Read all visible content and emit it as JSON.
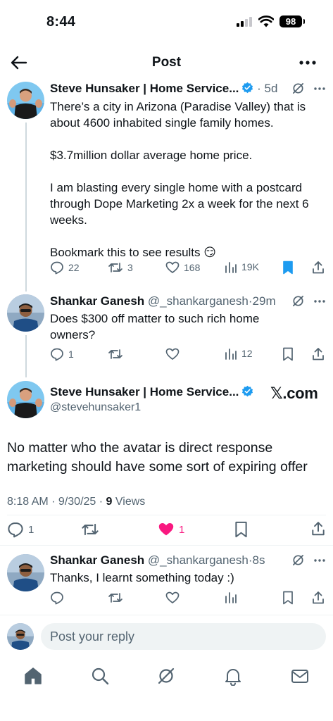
{
  "status_bar": {
    "time": "8:44",
    "battery": "98"
  },
  "header": {
    "title": "Post"
  },
  "posts": [
    {
      "author": "Steve Hunsaker | Home Service...",
      "time": "5d",
      "body": [
        "There’s a city in Arizona (Paradise Valley) that is about 4600 inhabited single family homes.",
        "$3.7million dollar average home price.",
        "I am blasting every single home with a postcard through Dope Marketing 2x a week for the next 6 weeks.",
        "Bookmark this to see results 😏"
      ],
      "replies": "22",
      "reposts": "3",
      "likes": "168",
      "views": "19K"
    },
    {
      "author": "Shankar Ganesh",
      "handle": "@_shankarganesh",
      "time": "29m",
      "body": "Does $300 off matter to such rich home owners?",
      "replies": "1",
      "views": "12"
    }
  ],
  "main_post": {
    "author": "Steve Hunsaker | Home Service...",
    "handle": "@stevehunsaker1",
    "source": "𝕏.com",
    "body": "No matter who the avatar is direct response marketing should have some sort of expiring offer",
    "timestamp": "8:18 AM · 9/30/25 · ",
    "views_count": "9",
    "views_label": " Views",
    "replies": "1",
    "likes": "1",
    "like_color": "#f91880"
  },
  "reply": {
    "author": "Shankar Ganesh",
    "handle": "@_shankarganesh",
    "time": "8s",
    "body": "Thanks, I learnt something today :)"
  },
  "compose": {
    "placeholder": "Post your reply"
  },
  "colors": {
    "accent": "#1d9bf0",
    "muted": "#536471",
    "text": "#0f1419"
  },
  "nav": [
    "home-icon",
    "search-icon",
    "grok-icon",
    "notifications-icon",
    "messages-icon"
  ]
}
